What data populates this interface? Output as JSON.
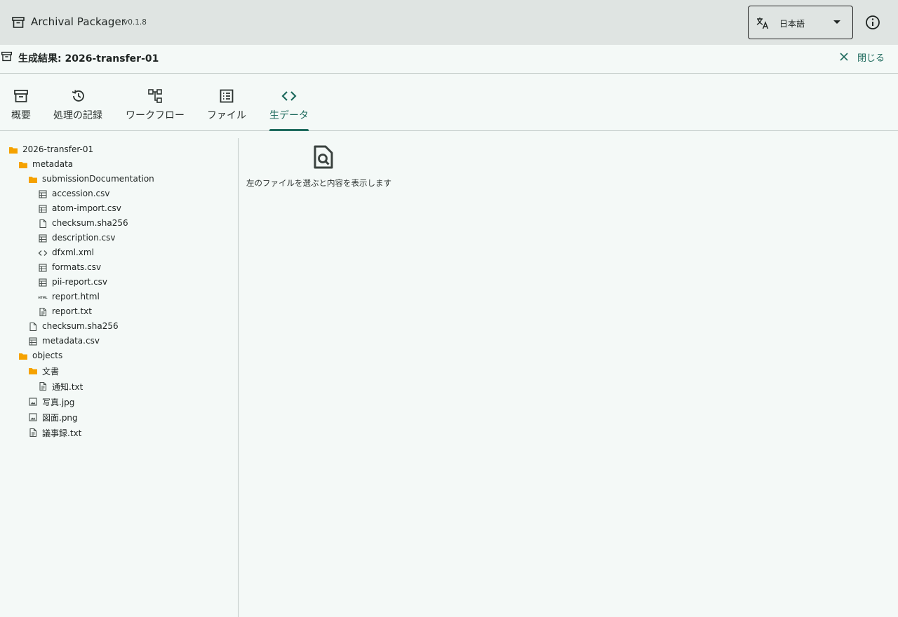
{
  "app": {
    "title": "Archival Packager",
    "version": "v0.1.8",
    "icon": "archive-box-icon"
  },
  "language": {
    "selected": "日本語",
    "icon": "translate-icon"
  },
  "info_icon": "info-icon",
  "result": {
    "title": "生成結果: 2026-transfer-01",
    "close_label": "閉じる"
  },
  "tabs": [
    {
      "label": "概要",
      "icon": "archive-icon",
      "active": false
    },
    {
      "label": "処理の記録",
      "icon": "history-icon",
      "active": false
    },
    {
      "label": "ワークフロー",
      "icon": "workflow-icon",
      "active": false
    },
    {
      "label": "ファイル",
      "icon": "list-icon",
      "active": false
    },
    {
      "label": "生データ",
      "icon": "code-icon",
      "active": true
    }
  ],
  "tree": [
    {
      "label": "2026-transfer-01",
      "type": "folder",
      "depth": 0
    },
    {
      "label": "metadata",
      "type": "folder",
      "depth": 1
    },
    {
      "label": "submissionDocumentation",
      "type": "folder",
      "depth": 2
    },
    {
      "label": "accession.csv",
      "type": "table",
      "depth": 3
    },
    {
      "label": "atom-import.csv",
      "type": "table",
      "depth": 3
    },
    {
      "label": "checksum.sha256",
      "type": "file",
      "depth": 3
    },
    {
      "label": "description.csv",
      "type": "table",
      "depth": 3
    },
    {
      "label": "dfxml.xml",
      "type": "code",
      "depth": 3
    },
    {
      "label": "formats.csv",
      "type": "table",
      "depth": 3
    },
    {
      "label": "pii-report.csv",
      "type": "table",
      "depth": 3
    },
    {
      "label": "report.html",
      "type": "html",
      "depth": 3
    },
    {
      "label": "report.txt",
      "type": "text",
      "depth": 3
    },
    {
      "label": "checksum.sha256",
      "type": "file",
      "depth": 2
    },
    {
      "label": "metadata.csv",
      "type": "table",
      "depth": 2
    },
    {
      "label": "objects",
      "type": "folder",
      "depth": 1
    },
    {
      "label": "文書",
      "type": "folder",
      "depth": 2
    },
    {
      "label": "通知.txt",
      "type": "text",
      "depth": 3
    },
    {
      "label": "写真.jpg",
      "type": "image",
      "depth": 2
    },
    {
      "label": "図面.png",
      "type": "image",
      "depth": 2
    },
    {
      "label": "議事録.txt",
      "type": "text",
      "depth": 2
    }
  ],
  "preview": {
    "message": "左のファイルを選ぶと内容を表示します",
    "icon": "file-search-icon"
  },
  "colors": {
    "accent": "#1f6b5e",
    "folder": "#f5a200",
    "appbar": "#dfe4e2",
    "background": "#f4f9f7"
  }
}
